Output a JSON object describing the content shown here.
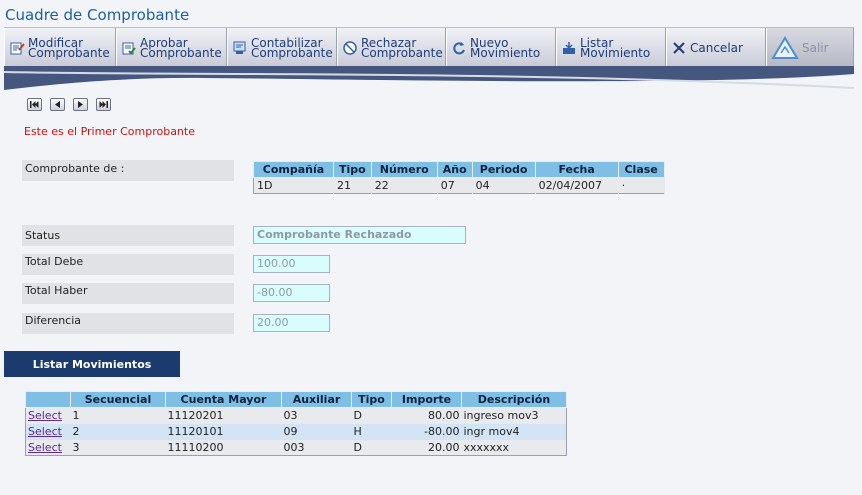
{
  "window": {
    "title": "Cuadre de Comprobante"
  },
  "toolbar": [
    {
      "label": "Modificar\nComprobante",
      "icon": "modify-icon"
    },
    {
      "label": "Aprobar\nComprobante",
      "icon": "approve-icon"
    },
    {
      "label": "Contabilizar\nComprobante",
      "icon": "account-icon"
    },
    {
      "label": "Rechazar\nComprobante",
      "icon": "reject-icon"
    },
    {
      "label": "Nuevo\nMovimiento",
      "icon": "refresh-icon"
    },
    {
      "label": "Listar\nMovimiento",
      "icon": "list-icon"
    },
    {
      "label": "Cancelar",
      "icon": "cancel-icon"
    },
    {
      "label": "Salir",
      "icon": "exit-icon"
    }
  ],
  "message": "Este es el Primer Comprobante",
  "labels": {
    "comprobante_de": "Comprobante de :",
    "status": "Status",
    "total_debe": "Total Debe",
    "total_haber": "Total Haber",
    "diferencia": "Diferencia"
  },
  "header_table": {
    "columns": [
      "Compañía",
      "Tipo",
      "Número",
      "Año",
      "Periodo",
      "Fecha",
      "Clase"
    ],
    "row": [
      "1D",
      "21",
      "22",
      "07",
      "04",
      "02/04/2007",
      "·"
    ]
  },
  "fields": {
    "status": "Comprobante Rechazado",
    "total_debe": "100.00",
    "total_haber": "-80.00",
    "diferencia": "20.00"
  },
  "list_button": "Listar Movimientos",
  "movements": {
    "columns": [
      "",
      "Secuencial",
      "Cuenta Mayor",
      "Auxiliar",
      "Tipo",
      "Importe",
      "Descripción"
    ],
    "rows": [
      {
        "select": "Select",
        "secuencial": "1",
        "cuenta": "11120201",
        "auxiliar": "03",
        "tipo": "D",
        "importe": "80.00",
        "descripcion": "ingreso mov3"
      },
      {
        "select": "Select",
        "secuencial": "2",
        "cuenta": "11120101",
        "auxiliar": "09",
        "tipo": "H",
        "importe": "-80.00",
        "descripcion": "ingr mov4"
      },
      {
        "select": "Select",
        "secuencial": "3",
        "cuenta": "11110200",
        "auxiliar": "003",
        "tipo": "D",
        "importe": "20.00",
        "descripcion": "xxxxxxx"
      }
    ]
  },
  "colors": {
    "title": "#1c5fa6",
    "header_bg": "#7fbfe5",
    "field_bg": "#d9fcfd",
    "message": "#cc1111",
    "list_button_bg": "#1b3a6e"
  }
}
